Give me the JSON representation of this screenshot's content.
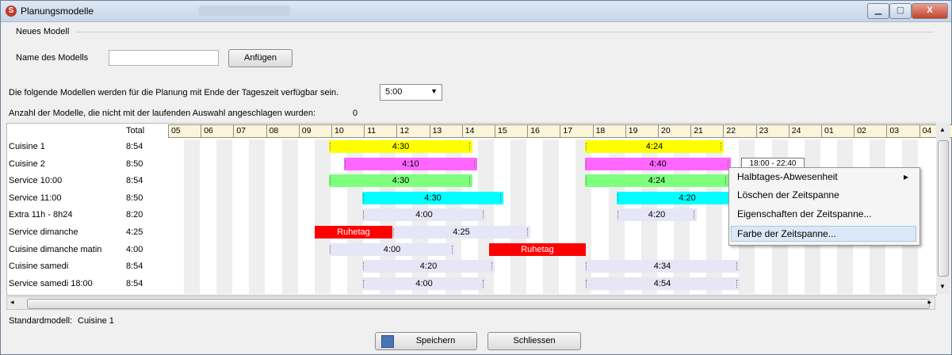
{
  "window": {
    "title": "Planungsmodelle",
    "controls": {
      "minimize": "▁",
      "maximize": "▢",
      "close": "X"
    }
  },
  "new_model": {
    "group_label": "Neues Modell",
    "name_label": "Name des Modells",
    "name_value": "",
    "add_button": "Anfügen"
  },
  "info": {
    "end_time_text": "Die folgende Modellen werden für die Planung mit Ende der Tageszeit verfügbar sein.",
    "end_time_value": "5:00",
    "count_text": "Anzahl der Modelle, die nicht mit der laufenden Auswahl angeschlagen wurden:",
    "count_value": "0"
  },
  "grid": {
    "total_header": "Total",
    "hours": [
      "05",
      "06",
      "07",
      "08",
      "09",
      "10",
      "11",
      "12",
      "13",
      "14",
      "15",
      "16",
      "17",
      "18",
      "19",
      "20",
      "21",
      "22",
      "23",
      "24",
      "01",
      "02",
      "03",
      "04"
    ],
    "rows": [
      {
        "name": "Cuisine 1",
        "total": "8:54",
        "bars": [
          {
            "label": "4:30",
            "color": "yellow"
          },
          {
            "label": "4:24",
            "color": "yellow"
          }
        ]
      },
      {
        "name": "Cuisine 2",
        "total": "8:50",
        "bars": [
          {
            "label": "4:10",
            "color": "pink"
          },
          {
            "label": "4:40",
            "color": "pink"
          },
          {
            "label": "18:00 - 22:40",
            "color": "white"
          }
        ]
      },
      {
        "name": "Service 10:00",
        "total": "8:54",
        "bars": [
          {
            "label": "4:30",
            "color": "green"
          },
          {
            "label": "4:24",
            "color": "green"
          }
        ]
      },
      {
        "name": "Service 11:00",
        "total": "8:50",
        "bars": [
          {
            "label": "4:30",
            "color": "cyan"
          },
          {
            "label": "4:20",
            "color": "cyan"
          }
        ]
      },
      {
        "name": "Extra 11h - 8h24",
        "total": "8:20",
        "bars": [
          {
            "label": "4:00",
            "color": "light"
          },
          {
            "label": "4:20",
            "color": "light"
          }
        ]
      },
      {
        "name": "Service dimanche",
        "total": "4:25",
        "bars": [
          {
            "label": "Ruhetag",
            "color": "red"
          },
          {
            "label": "4:25",
            "color": "light"
          }
        ]
      },
      {
        "name": "Cuisine dimanche matin",
        "total": "4:00",
        "bars": [
          {
            "label": "4:00",
            "color": "light"
          },
          {
            "label": "Ruhetag",
            "color": "red"
          }
        ]
      },
      {
        "name": "Cuisine samedi",
        "total": "8:54",
        "bars": [
          {
            "label": "4:20",
            "color": "light"
          },
          {
            "label": "4:34",
            "color": "light"
          }
        ]
      },
      {
        "name": "Service samedi 18:00",
        "total": "8:54",
        "bars": [
          {
            "label": "4:00",
            "color": "light"
          },
          {
            "label": "4:54",
            "color": "light"
          }
        ]
      }
    ]
  },
  "context_menu": {
    "items": [
      "Halbtages-Abwesenheit",
      "Löschen der Zeitspanne",
      "Eigenschaften der Zeitspanne...",
      "Farbe der Zeitspanne..."
    ],
    "submenu_arrow": "▸",
    "selected": "Farbe der Zeitspanne..."
  },
  "footer": {
    "default_model_label": "Standardmodell:",
    "default_model_value": "Cuisine 1",
    "save_button": "Speichern",
    "close_button": "Schliessen"
  },
  "colors": {
    "yellow": "#ffff00",
    "pink": "#ff66ff",
    "green": "#7eff7e",
    "cyan": "#00ffff",
    "light": "#e6e6f6",
    "red": "#ff0000",
    "header": "#fbf4d9",
    "selection": "#dbe8f7"
  }
}
